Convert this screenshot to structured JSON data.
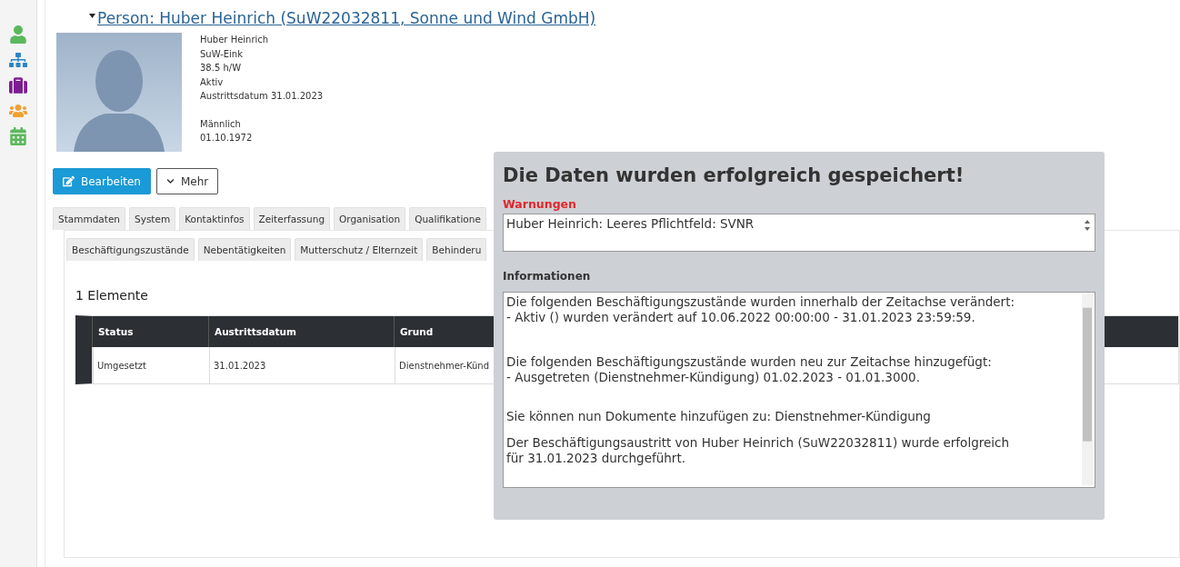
{
  "sidebar": {
    "items": [
      {
        "kind": "person"
      },
      {
        "kind": "org"
      },
      {
        "kind": "briefcase"
      },
      {
        "kind": "group"
      },
      {
        "kind": "calendar"
      }
    ]
  },
  "title": "Person: Huber Heinrich (SuW22032811, Sonne und Wind GmbH)",
  "profile": {
    "lines": [
      "Huber Heinrich",
      "SuW-Eink",
      "38.5 h/W",
      "Aktiv",
      "Austrittsdatum 31.01.2023"
    ],
    "lines_2": [
      "Männlich",
      "01.10.1972"
    ]
  },
  "buttons": [
    {
      "kind": "primary",
      "label": "Bearbeiten"
    },
    {
      "kind": "dropdown",
      "label": "Mehr"
    }
  ],
  "tabs": [
    "Stammdaten",
    "System",
    "Kontaktinfos",
    "Zeiterfassung",
    "Organisation",
    "Qualifikatione"
  ],
  "subtabs": [
    "Beschäftigungszustände",
    "Nebentätigkeiten",
    "Mutterschutz / Elternzeit",
    "Behinderu"
  ],
  "table": {
    "count": "1 Elemente",
    "columns": [
      "Status",
      "Austrittsdatum",
      "Grund"
    ],
    "rows": [
      [
        "Umgesetzt",
        "31.01.2023",
        "Dienstnehmer-Künd"
      ]
    ]
  },
  "dialog": {
    "title": "Die Daten wurden erfolgreich gespeichert!",
    "warnings_label": "Warnungen",
    "warnings": [
      "Huber Heinrich: Leeres Pflichtfeld: SVNR"
    ],
    "info_label": "Informationen",
    "info": [
      [
        "Die folgenden Beschäftigungszustände wurden innerhalb der Zeitachse verändert:",
        "- Aktiv () wurden verändert auf 10.06.2022 00:00:00 - 31.01.2023 23:59:59."
      ],
      [
        "Die folgenden Beschäftigungszustände wurden neu zur Zeitachse hinzugefügt:",
        "- Ausgetreten (Dienstnehmer-Kündigung) 01.02.2023 - 01.01.3000."
      ],
      [
        "Sie können nun Dokumente hinzufügen zu: Dienstnehmer-Kündigung"
      ],
      [
        "Der Beschäftigungsaustritt von Huber Heinrich (SuW22032811) wurde erfolgreich",
        "für 31.01.2023 durchgeführt."
      ]
    ]
  }
}
